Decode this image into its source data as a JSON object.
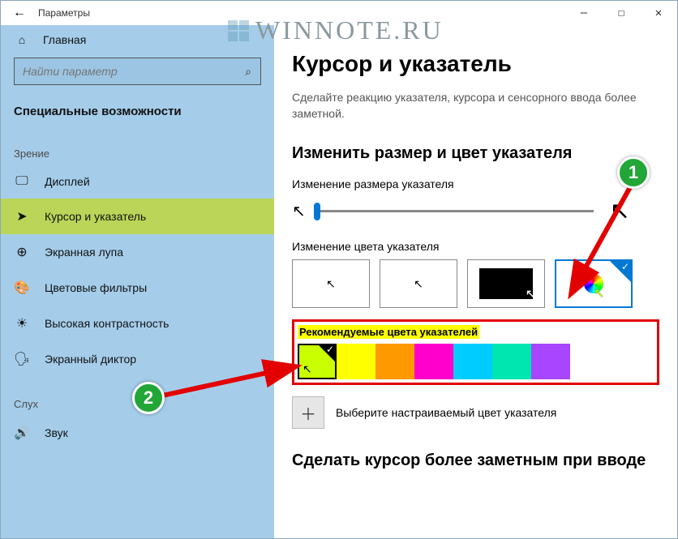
{
  "titlebar": {
    "app_title": "Параметры",
    "min": "—",
    "max": "☐",
    "close": "✕"
  },
  "sidebar": {
    "back_icon": "←",
    "home_icon": "⌂",
    "home_label": "Главная",
    "search_placeholder": "Найти параметр",
    "search_icon": "⌕",
    "section_label": "Специальные возможности",
    "group_vision": "Зрение",
    "group_hearing": "Слух",
    "items": [
      {
        "icon": "🖵",
        "label": "Дисплей"
      },
      {
        "icon": "➤",
        "label": "Курсор и указатель"
      },
      {
        "icon": "⊕",
        "label": "Экранная лупа"
      },
      {
        "icon": "🎨",
        "label": "Цветовые фильтры"
      },
      {
        "icon": "☀",
        "label": "Высокая контрастность"
      },
      {
        "icon": "🗣",
        "label": "Экранный диктор"
      }
    ],
    "sound": {
      "icon": "🔊",
      "label": "Звук"
    }
  },
  "content": {
    "heading": "Курсор и указатель",
    "lead": "Сделайте реакцию указателя, курсора и сенсорного ввода более заметной.",
    "section_size": "Изменить размер и цвет указателя",
    "size_label": "Изменение размера указателя",
    "color_label": "Изменение цвета указателя",
    "rec_title": "Рекомендуемые цвета указателей",
    "custom_label": "Выберите настраиваемый цвет указателя",
    "section_cursor": "Сделать курсор более заметным при вводе",
    "swatch_colors": [
      "#caff00",
      "#ffff00",
      "#ff9900",
      "#ff00cc",
      "#00ccff",
      "#00e6b0",
      "#a846ff"
    ]
  },
  "annotations": {
    "badge1": "1",
    "badge2": "2"
  },
  "watermark": {
    "text": "WINNOTE.RU"
  }
}
